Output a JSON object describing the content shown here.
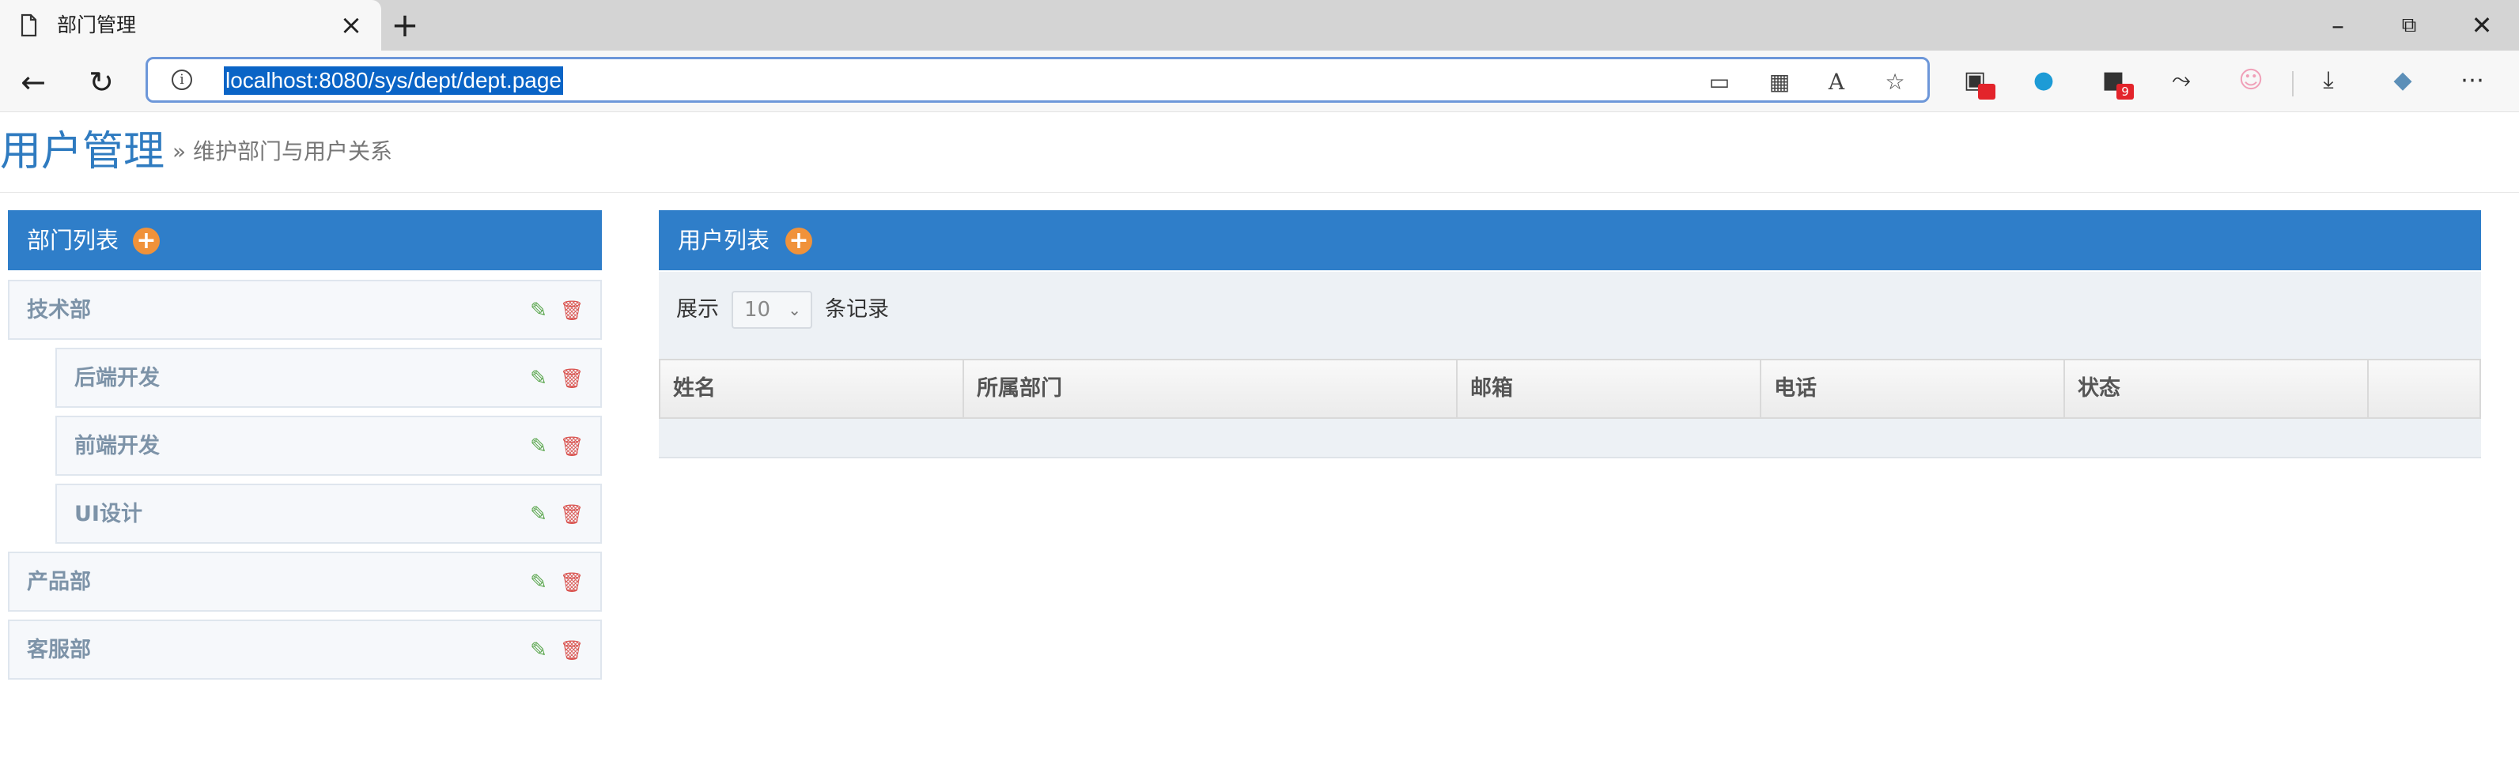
{
  "browser": {
    "tab_title": "部门管理",
    "url": "localhost:8080/sys/dept/dept.page",
    "badges": {
      "ext1": "",
      "ext3": "9"
    }
  },
  "page": {
    "title": "用户管理",
    "subtitle": "» 维护部门与用户关系"
  },
  "dept_panel": {
    "title": "部门列表",
    "items": [
      {
        "label": "技术部",
        "level": 0
      },
      {
        "label": "后端开发",
        "level": 1
      },
      {
        "label": "前端开发",
        "level": 1
      },
      {
        "label": "UI设计",
        "level": 1
      },
      {
        "label": "产品部",
        "level": 0
      },
      {
        "label": "客服部",
        "level": 0
      }
    ]
  },
  "user_panel": {
    "title": "用户列表",
    "show_label": "展示",
    "page_size": "10",
    "records_label": "条记录",
    "columns": [
      "姓名",
      "所属部门",
      "邮箱",
      "电话",
      "状态",
      ""
    ]
  },
  "colors": {
    "accent": "#2f7ec9",
    "add_button": "#f0923a",
    "edit": "#5aa64d",
    "delete": "#d9534f"
  }
}
